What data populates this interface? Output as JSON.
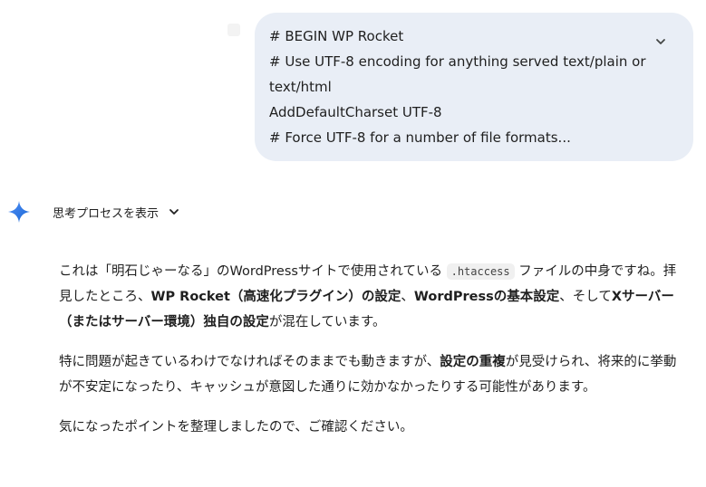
{
  "user_message": {
    "lines": [
      "# BEGIN WP Rocket",
      "# Use UTF-8 encoding for anything served text/plain or",
      "text/html",
      "AddDefaultCharset UTF-8",
      "# Force UTF-8 for a number of file formats..."
    ]
  },
  "thinking": {
    "label": "思考プロセスを表示"
  },
  "response": {
    "p1": {
      "a": "これは「明石じゃーなる」のWordPressサイトで使用されている",
      "code": ".htaccess",
      "b": "ファイルの中身ですね。拝見したところ、",
      "b1": "WP Rocket（高速化プラグイン）の設定",
      "c": "、",
      "b2": "WordPressの基本設定",
      "d": "、そして",
      "b3": "Xサーバー（またはサーバー環境）独自の設定",
      "e": "が混在しています。"
    },
    "p2": {
      "a": "特に問題が起きているわけでなければそのままでも動きますが、",
      "b1": "設定の重複",
      "c": "が見受けられ、将来的に挙動が不安定になったり、キャッシュが意図した通りに効かなかったりする可能性があります。"
    },
    "p3": "気になったポイントを整理しましたので、ご確認ください。"
  },
  "colors": {
    "bubble": "#e9eef6",
    "sparkle_start": "#4285f4",
    "sparkle_end": "#1a73e8"
  }
}
